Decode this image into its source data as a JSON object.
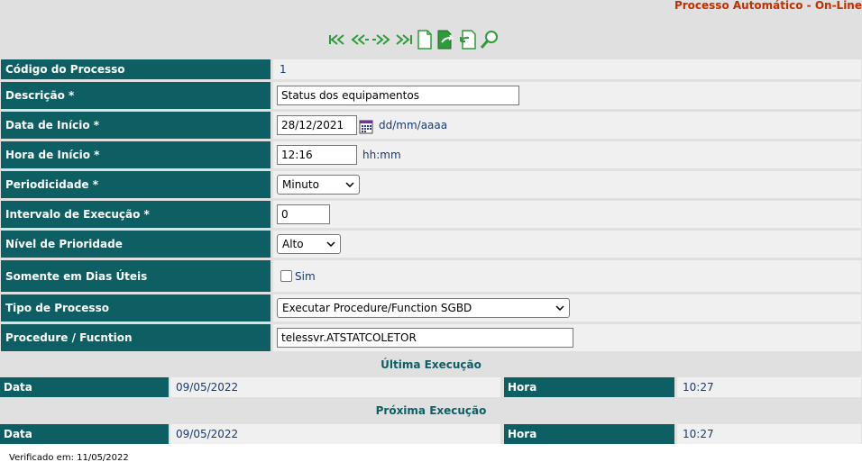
{
  "header": {
    "title": "Processo Automático - On-Line"
  },
  "toolbar": {
    "icons": [
      "first-icon",
      "previous-icon",
      "next-icon",
      "last-icon",
      "new-document-icon",
      "export-icon",
      "undo-icon",
      "search-icon"
    ],
    "accent": "#2e9a3a"
  },
  "form": {
    "codigo": {
      "label": "Código do Processo",
      "value": "1"
    },
    "descricao": {
      "label": "Descrição *",
      "value": "Status dos equipamentos"
    },
    "data_inicio": {
      "label": "Data de Início *",
      "value": "28/12/2021",
      "hint": "dd/mm/aaaa"
    },
    "hora_inicio": {
      "label": "Hora de Início *",
      "value": "12:16",
      "hint": "hh:mm"
    },
    "periodicidade": {
      "label": "Periodicidade *",
      "value": "Minuto"
    },
    "intervalo": {
      "label": "Intervalo de Execução *",
      "value": "0"
    },
    "prioridade": {
      "label": "Nível de Prioridade",
      "value": "Alto"
    },
    "dias_uteis": {
      "label": "Somente em Dias Úteis",
      "option": "Sim",
      "checked": false
    },
    "tipo": {
      "label": "Tipo de Processo",
      "value": "Executar Procedure/Function SGBD"
    },
    "procedure": {
      "label": "Procedure / Fucntion",
      "value": "telessvr.ATSTATCOLETOR"
    }
  },
  "ultima": {
    "title": "Última Execução",
    "data_label": "Data",
    "data_value": "09/05/2022",
    "hora_label": "Hora",
    "hora_value": "10:27"
  },
  "proxima": {
    "title": "Próxima Execução",
    "data_label": "Data",
    "data_value": "09/05/2022",
    "hora_label": "Hora",
    "hora_value": "10:27"
  },
  "footer": {
    "verified": "Verificado em: 11/05/2022"
  },
  "colors": {
    "label_bg": "#0e5f63",
    "title": "#c03000",
    "value_text": "#1a3a6e"
  }
}
